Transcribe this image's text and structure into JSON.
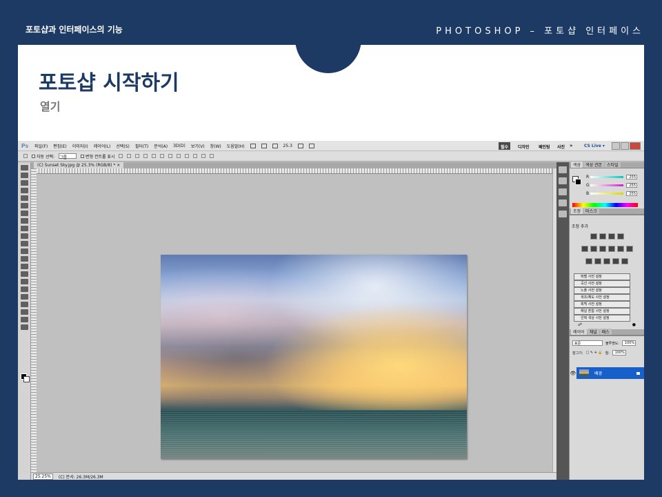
{
  "slide": {
    "header_left": "포토샵과 인터페이스의 기능",
    "header_right": "PHOTOSHOP – 포토샵 인터페이스",
    "title": "포토샵 시작하기",
    "subtitle": "열기"
  },
  "photoshop": {
    "logo": "Ps",
    "menu": [
      "파일(F)",
      "편집(E)",
      "이미지(I)",
      "레이어(L)",
      "선택(S)",
      "필터(T)",
      "분석(A)",
      "3D(D)",
      "보기(V)",
      "창(W)",
      "도움말(H)"
    ],
    "zoom_menu": "25.3",
    "workspaces": [
      "필수",
      "디자인",
      "페인팅",
      "사진"
    ],
    "more": "»",
    "cs_live": "CS Live ▾",
    "options": {
      "auto_select": "자동 선택:",
      "auto_select_value": "그룹",
      "show_transform": "변형 컨트롤 표시"
    },
    "doc_tab": "(C) Sunset Sky.jpg @ 25.3% (RGB/8) * ×",
    "status": {
      "zoom": "25.25%",
      "info": "(C) 문서: 26.3M/26.3M"
    },
    "color_panel": {
      "tabs": [
        "색상",
        "색상 견본",
        "스타일"
      ],
      "channels": [
        {
          "name": "R",
          "value": "255",
          "color": "#00c8c8"
        },
        {
          "name": "G",
          "value": "255",
          "color": "#d020d0"
        },
        {
          "name": "B",
          "value": "255",
          "color": "#d8d800"
        }
      ]
    },
    "adjustments_panel": {
      "tabs": [
        "조정",
        "마스크"
      ],
      "label": "조정 추가",
      "presets": [
        "레벨 사전 설정",
        "곡선 사전 설정",
        "노출 사전 설정",
        "색조/채도 사전 설정",
        "흑백 사전 설정",
        "채널 혼합 사전 설정",
        "선택 색상 사전 설정"
      ]
    },
    "layers_panel": {
      "tabs": [
        "레이어",
        "채널",
        "패스"
      ],
      "blend_mode": "표준",
      "opacity_label": "불투명도:",
      "opacity": "100%",
      "lock_label": "잠그기:",
      "fill_label": "칠:",
      "fill": "100%",
      "layer_name": "배경"
    }
  }
}
